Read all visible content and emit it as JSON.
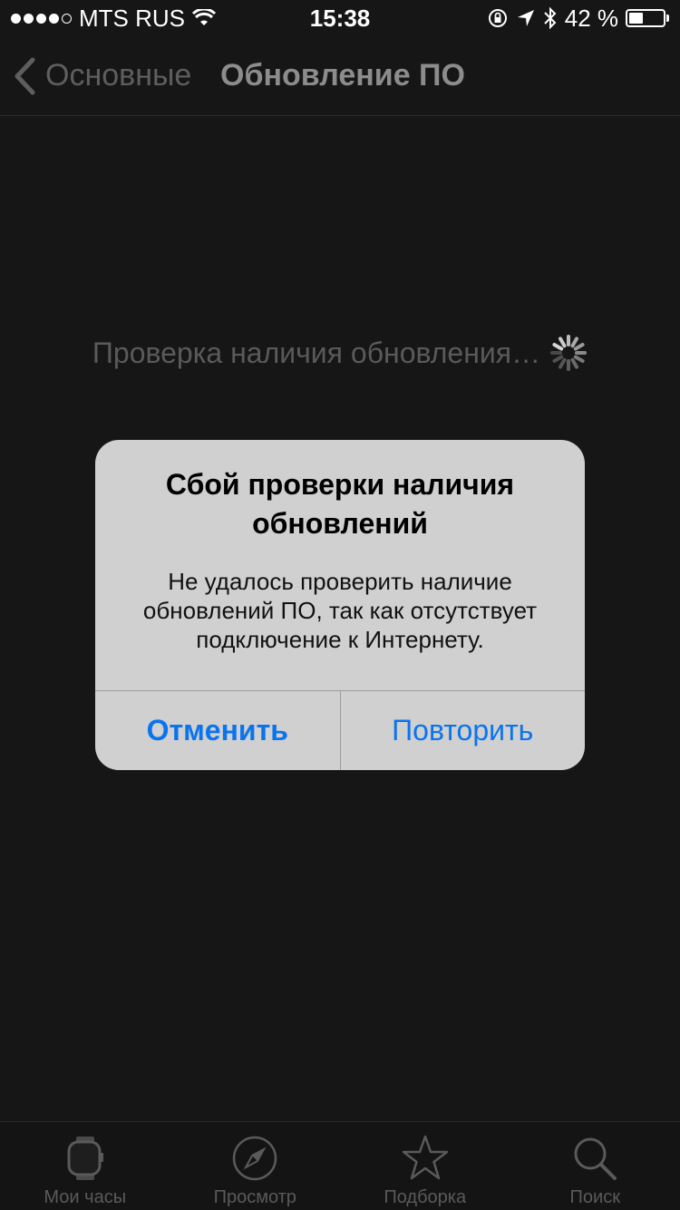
{
  "status_bar": {
    "carrier": "MTS RUS",
    "time": "15:38",
    "battery_percent_label": "42 %",
    "battery_level": 0.42,
    "signal_bars_filled": 4,
    "signal_bars_total": 5
  },
  "nav": {
    "back_label": "Основные",
    "title": "Обновление ПО"
  },
  "content": {
    "checking_text": "Проверка наличия обновления…"
  },
  "alert": {
    "title": "Сбой проверки наличия\nобновлений",
    "message": "Не удалось проверить наличие\nобновлений ПО, так как отсутствует\nподключение к Интернету.",
    "cancel_label": "Отменить",
    "retry_label": "Повторить"
  },
  "tab_bar": {
    "items": [
      {
        "label": "Мои часы",
        "icon": "watch-icon"
      },
      {
        "label": "Просмотр",
        "icon": "compass-icon"
      },
      {
        "label": "Подборка",
        "icon": "star-icon"
      },
      {
        "label": "Поиск",
        "icon": "search-icon"
      }
    ]
  },
  "colors": {
    "accent": "#0a74ef",
    "background": "#161616",
    "alert_background": "#d0d0d0"
  }
}
